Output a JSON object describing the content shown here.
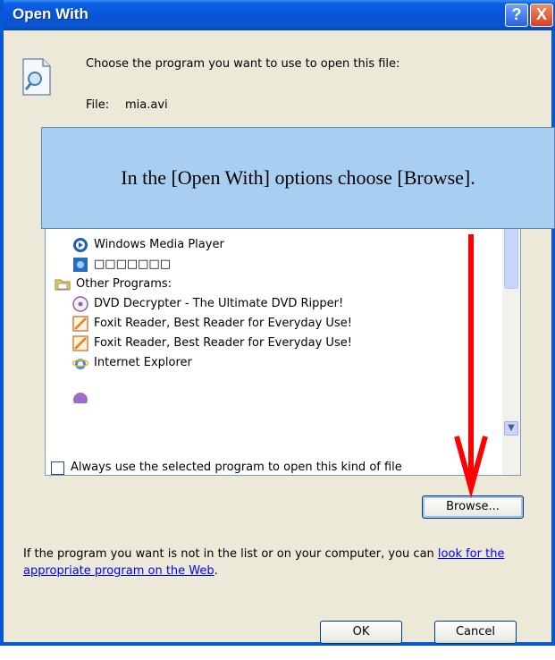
{
  "window": {
    "title": "Open With",
    "help_label": "?",
    "close_label": "X"
  },
  "header": {
    "prompt": "Choose the program you want to use to open this file:",
    "file_label": "File:",
    "file_name": "mia.avi"
  },
  "list": {
    "items": [
      {
        "label": "Windows Media Player",
        "icon": "media-player-icon"
      },
      {
        "label": "□□□□□□□",
        "icon": "app-icon"
      },
      {
        "label": "Other Programs:",
        "icon": "folder-icon"
      },
      {
        "label": "DVD Decrypter - The Ultimate DVD Ripper!",
        "icon": "disc-icon"
      },
      {
        "label": "Foxit Reader, Best Reader for Everyday Use!",
        "icon": "foxit-icon"
      },
      {
        "label": "Foxit Reader, Best Reader for Everyday Use!",
        "icon": "foxit-icon"
      },
      {
        "label": "Internet Explorer",
        "icon": "internet-explorer-icon"
      }
    ]
  },
  "options": {
    "always_use_label": "Always use the selected program to open this kind of file",
    "always_use_checked": false
  },
  "buttons": {
    "browse": "Browse...",
    "ok": "OK",
    "cancel": "Cancel"
  },
  "hint": {
    "text": "If the program you want is not in the list or on your computer, you can ",
    "link": "look for the appropriate program on the Web",
    "end": "."
  },
  "callout": {
    "text": "In the [Open With] options choose [Browse]."
  },
  "colors": {
    "titlebar": "#0856D8",
    "dialog_bg": "#ECE9D8",
    "callout_bg": "#A8CEF2",
    "arrow": "#FF0000",
    "link": "#0000FF"
  }
}
